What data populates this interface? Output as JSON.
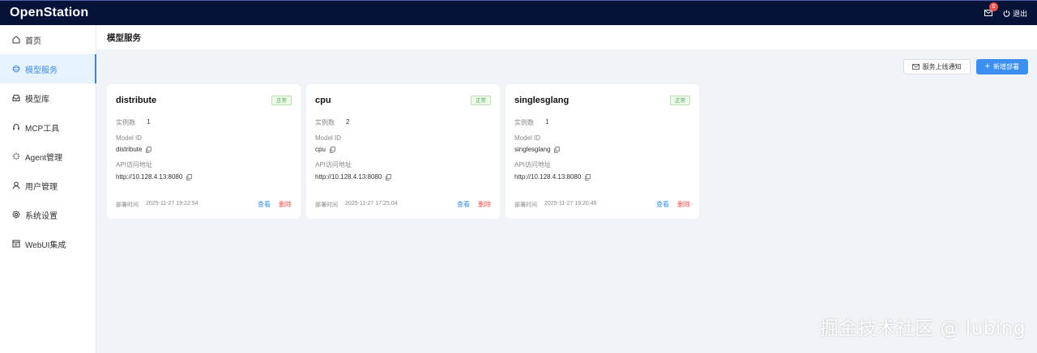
{
  "app": {
    "title": "OpenStation"
  },
  "topbar": {
    "notification_count": "0",
    "logout_label": "退出"
  },
  "sidebar": {
    "items": [
      {
        "label": "首页",
        "icon": "home-icon"
      },
      {
        "label": "模型服务",
        "icon": "model-service-icon",
        "active": true
      },
      {
        "label": "模型库",
        "icon": "model-library-icon"
      },
      {
        "label": "MCP工具",
        "icon": "mcp-tool-icon"
      },
      {
        "label": "Agent管理",
        "icon": "agent-icon"
      },
      {
        "label": "用户管理",
        "icon": "user-icon"
      },
      {
        "label": "系统设置",
        "icon": "gear-icon"
      },
      {
        "label": "WebUI集成",
        "icon": "webui-icon"
      }
    ]
  },
  "page": {
    "title": "模型服务",
    "notify_button": "服务上线通知",
    "add_button": "新增部署"
  },
  "card_labels": {
    "instances": "实例数",
    "model_id": "Model ID",
    "api_address": "API访问地址",
    "deploy_time": "部署时间",
    "view": "查看",
    "delete": "删除"
  },
  "services": [
    {
      "name": "distribute",
      "status": "正常",
      "instances": "1",
      "model_id": "distribute",
      "api": "http://10.128.4.13:8080",
      "deploy_time": "2025-11-27 19:22:54"
    },
    {
      "name": "cpu",
      "status": "正常",
      "instances": "2",
      "model_id": "cpu",
      "api": "http://10.128.4.13:8080",
      "deploy_time": "2025-11-27 17:25:04"
    },
    {
      "name": "singlesglang",
      "status": "正常",
      "instances": "1",
      "model_id": "singlesglang",
      "api": "http://10.128.4.13:8080",
      "deploy_time": "2025-11-27 19:20:46"
    }
  ],
  "watermark": "掘金技术社区 @ lubing",
  "colors": {
    "topbar": "#061238",
    "accent": "#3c8ff0",
    "danger": "#e8534f",
    "success": "#4aaa52"
  }
}
